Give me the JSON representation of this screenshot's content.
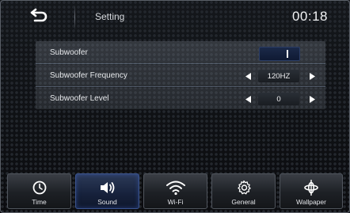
{
  "header": {
    "title": "Setting",
    "clock": "00:18"
  },
  "settings": {
    "rows": [
      {
        "label": "Subwoofer",
        "control": "toggle",
        "state": "on"
      },
      {
        "label": "Subwoofer Frequency",
        "control": "selector",
        "value": "120HZ"
      },
      {
        "label": "Subwoofer Level",
        "control": "selector",
        "value": "0"
      }
    ]
  },
  "tabs": [
    {
      "label": "Time",
      "icon": "clock-icon",
      "active": false
    },
    {
      "label": "Sound",
      "icon": "speaker-icon",
      "active": true
    },
    {
      "label": "Wi-Fi",
      "icon": "wifi-icon",
      "active": false
    },
    {
      "label": "General",
      "icon": "gear-icon",
      "active": false
    },
    {
      "label": "Wallpaper",
      "icon": "wallpaper-icon",
      "active": false
    }
  ],
  "colors": {
    "active_tab": "#1b2a49",
    "toggle_on": "#1b2a49",
    "text": "#e6e8ec"
  }
}
